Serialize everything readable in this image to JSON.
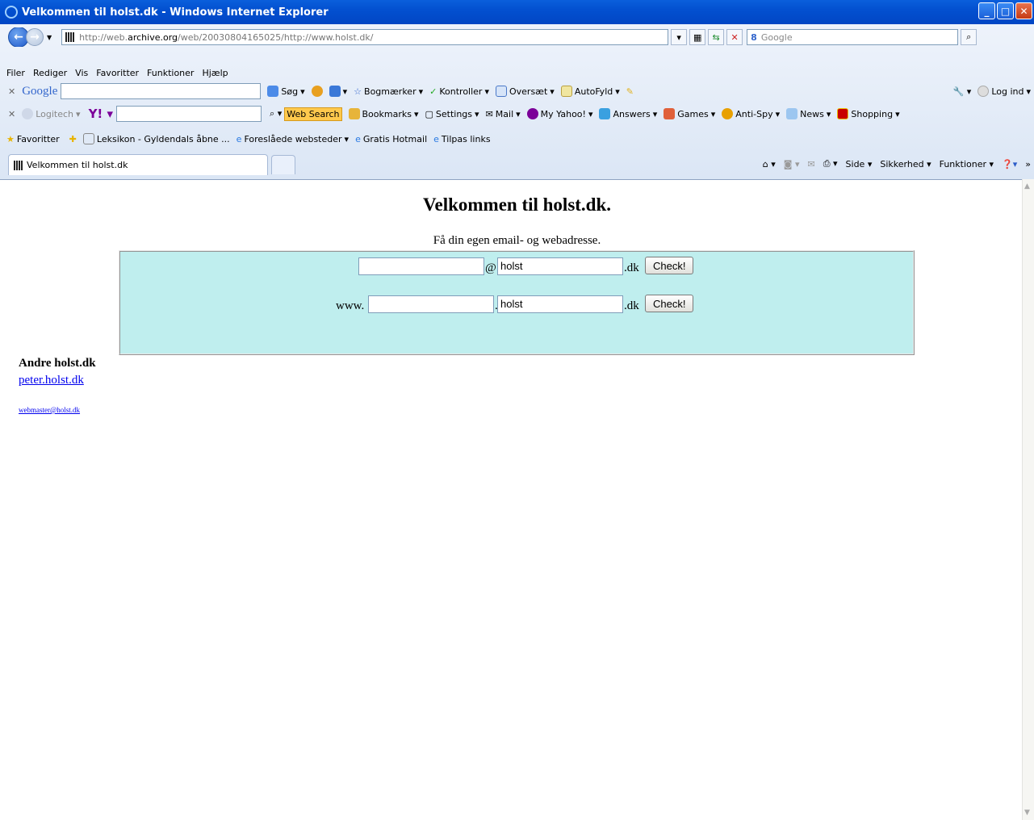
{
  "window": {
    "title": "Velkommen til holst.dk - Windows Internet Explorer"
  },
  "address": {
    "url_prefix": "http://web.",
    "url_domain": "archive.org",
    "url_rest": "/web/20030804165025/http://www.holst.dk/"
  },
  "search": {
    "placeholder": "Google"
  },
  "menu": [
    "Filer",
    "Rediger",
    "Vis",
    "Favoritter",
    "Funktioner",
    "Hjælp"
  ],
  "google_toolbar": {
    "brand": "Google",
    "search": "Søg",
    "bookmarks": "Bogmærker",
    "spell": "Kontroller",
    "translate": "Oversæt",
    "autofill": "AutoFyld",
    "login": "Log ind"
  },
  "yahoo_toolbar": {
    "logitech": "Logitech",
    "websearch": "Web Search",
    "bookmarks": "Bookmarks",
    "settings": "Settings",
    "mail": "Mail",
    "myyahoo": "My Yahoo!",
    "answers": "Answers",
    "games": "Games",
    "antispy": "Anti-Spy",
    "news": "News",
    "shopping": "Shopping"
  },
  "favorites_bar": {
    "label": "Favoritter",
    "items": [
      "Leksikon - Gyldendals åbne ...",
      "Foreslåede websteder",
      "Gratis Hotmail",
      "Tilpas links"
    ]
  },
  "tab": {
    "title": "Velkommen til holst.dk"
  },
  "commandbar": {
    "page": "Side",
    "safety": "Sikkerhed",
    "tools": "Funktioner"
  },
  "page": {
    "heading": "Velkommen til holst.dk.",
    "subheading": "Få din egen email- og webadresse.",
    "email_row": {
      "at": "@",
      "domain_value": "holst",
      "suffix": ".dk",
      "button": "Check!"
    },
    "web_row": {
      "prefix": "www.",
      "dot": ".",
      "domain_value": "holst",
      "suffix": ".dk",
      "button": "Check!"
    },
    "others_heading": "Andre holst.dk",
    "others_link": "peter.holst.dk",
    "webmaster": "webmaster@holst.dk"
  }
}
